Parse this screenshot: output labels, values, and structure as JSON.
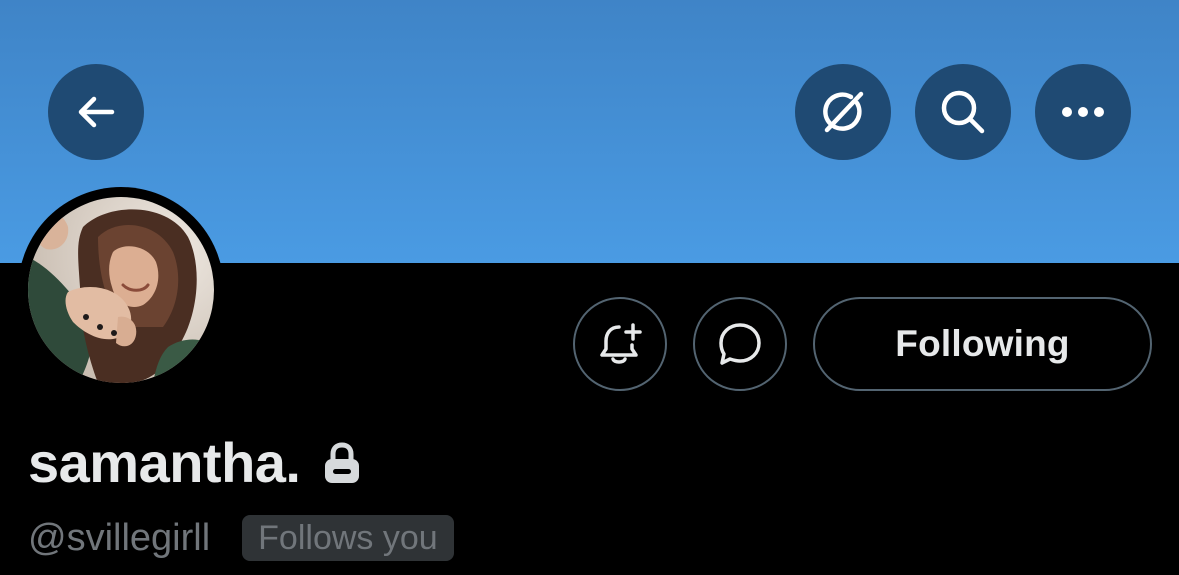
{
  "header": {
    "banner_color": "#4a9be3",
    "buttons": [
      {
        "name": "back",
        "icon": "arrow-left-icon"
      },
      {
        "name": "grok",
        "icon": "grok-icon"
      },
      {
        "name": "search",
        "icon": "search-icon"
      },
      {
        "name": "more",
        "icon": "ellipsis-icon"
      }
    ]
  },
  "profile": {
    "display_name": "samantha.",
    "protected_icon": "lock-icon",
    "handle": "@svillegirll",
    "follows_you_label": "Follows you",
    "avatar": "profile-photo"
  },
  "actions": {
    "notify_icon": "bell-plus-icon",
    "message_icon": "message-bubble-icon",
    "following_label": "Following"
  }
}
